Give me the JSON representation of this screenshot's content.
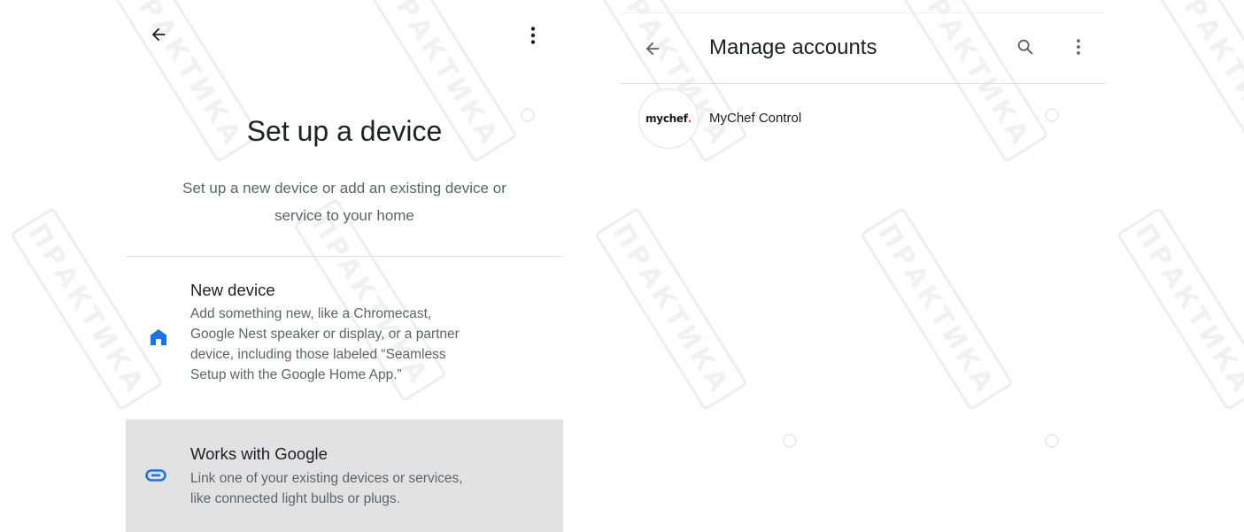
{
  "left_screen": {
    "top_bar": {
      "back_icon": "arrow-back-icon",
      "overflow_icon": "more-vert-icon"
    },
    "title": "Set up a device",
    "subtitle_line1": "Set up a new device or add an existing device or",
    "subtitle_line2": "service to your home",
    "options": [
      {
        "icon": "home-icon",
        "title": "New device",
        "description_lines": [
          "Add something new, like a Chromecast,",
          "Google Nest speaker or display, or a partner",
          "device, including those labeled “Seamless",
          "Setup with the Google Home App.”"
        ]
      },
      {
        "icon": "link-icon",
        "title": "Works with Google",
        "description_lines": [
          "Link one of your existing devices or services,",
          "like connected light bulbs or plugs."
        ]
      }
    ]
  },
  "right_screen": {
    "app_bar": {
      "back_icon": "arrow-back-icon",
      "title": "Manage accounts",
      "search_icon": "search-icon",
      "overflow_icon": "more-vert-icon"
    },
    "accounts": [
      {
        "logo_text": "mychef",
        "logo_dot": ".",
        "name": "MyChef Control"
      }
    ]
  },
  "colors": {
    "home_icon": "#1a73e8",
    "link_icon": "#1a73e8",
    "selected_row_bg": "#e2e2e2",
    "brand_dot": "#e53935"
  }
}
